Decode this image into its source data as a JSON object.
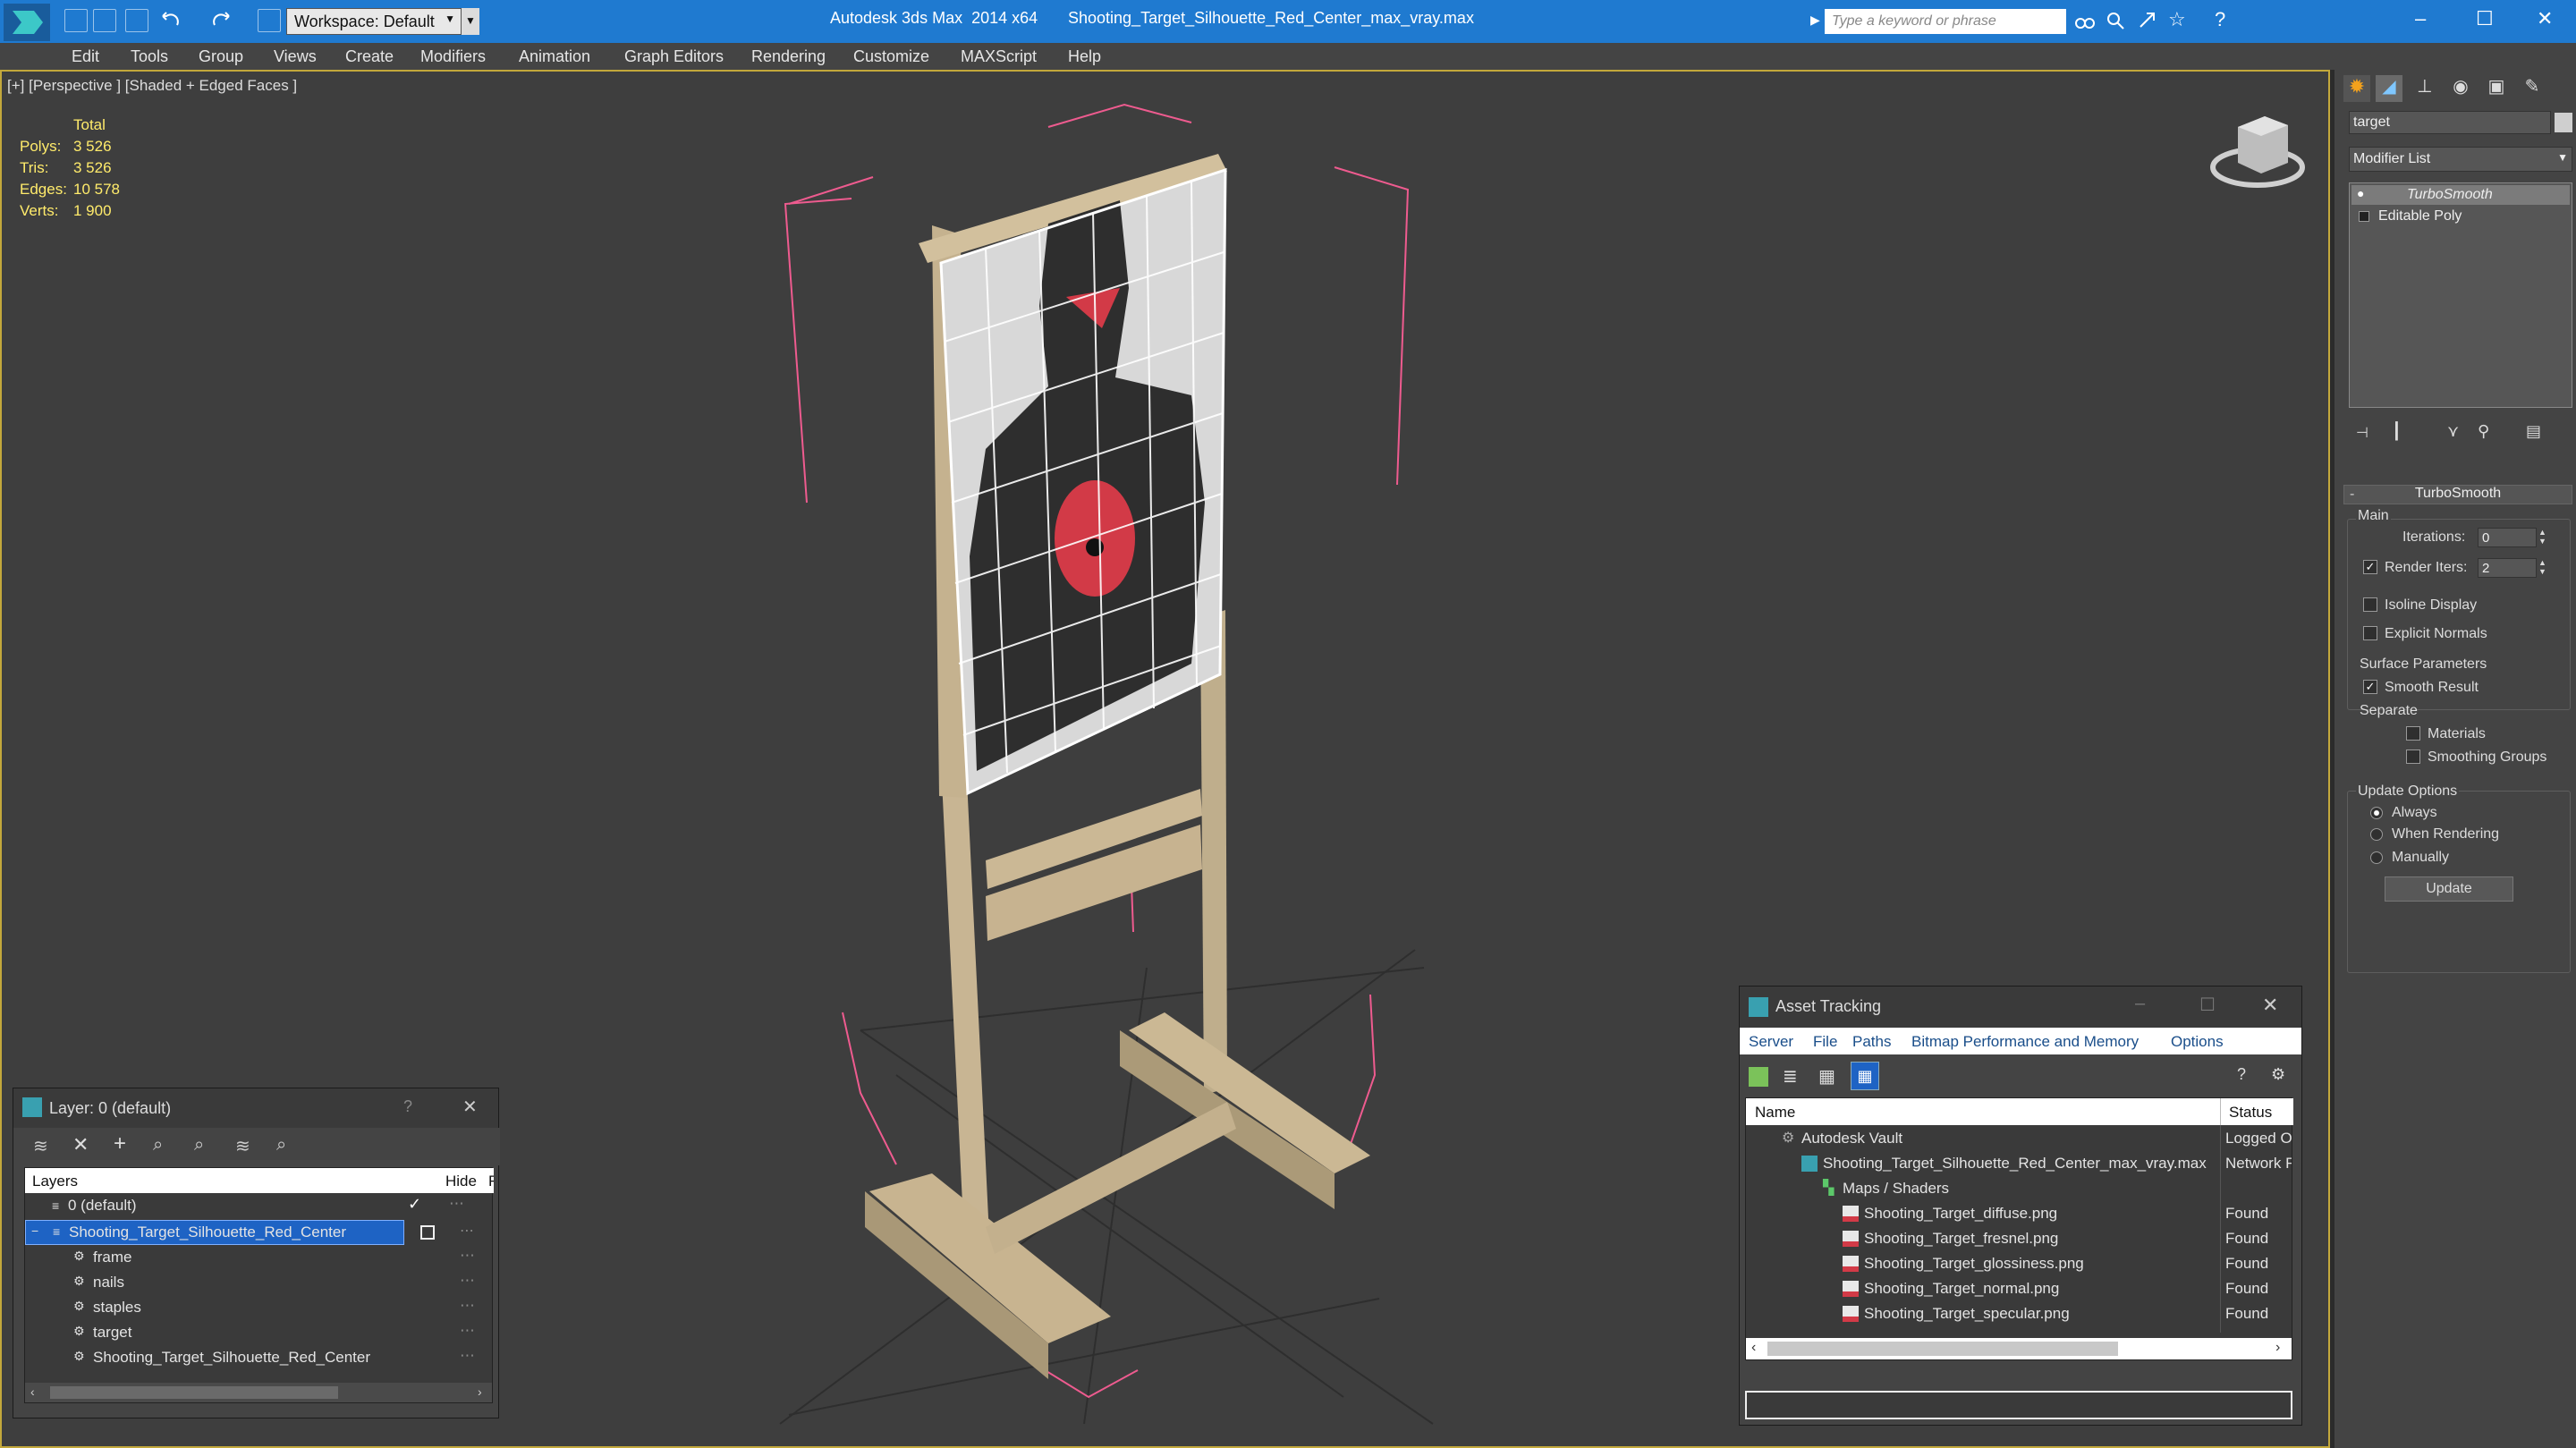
{
  "title": {
    "app": "Autodesk 3ds Max  2014 x64",
    "file": "Shooting_Target_Silhouette_Red_Center_max_vray.max"
  },
  "workspace": "Workspace: Default",
  "search": {
    "placeholder": "Type a keyword or phrase"
  },
  "menu": [
    "Edit",
    "Tools",
    "Group",
    "Views",
    "Create",
    "Modifiers",
    "Animation",
    "Graph Editors",
    "Rendering",
    "Customize",
    "MAXScript",
    "Help"
  ],
  "viewport": {
    "label": "[+] [Perspective ] [Shaded + Edged Faces ]",
    "stats": {
      "total_label": "Total",
      "rows": [
        {
          "k": "Polys:",
          "v": "3 526"
        },
        {
          "k": "Tris:",
          "v": "3 526"
        },
        {
          "k": "Edges:",
          "v": "10 578"
        },
        {
          "k": "Verts:",
          "v": "1 900"
        }
      ]
    }
  },
  "command_panel": {
    "object_name": "target",
    "modifier_list": "Modifier List",
    "stack": [
      "TurboSmooth",
      "Editable Poly"
    ],
    "rollout_title": "TurboSmooth",
    "main_label": "Main",
    "iterations_label": "Iterations:",
    "iterations_value": "0",
    "render_iters_label": "Render Iters:",
    "render_iters_value": "2",
    "render_iters_checked": true,
    "isoline_label": "Isoline Display",
    "explicit_label": "Explicit Normals",
    "surface_label": "Surface Parameters",
    "smooth_label": "Smooth Result",
    "smooth_checked": true,
    "separate_label": "Separate",
    "materials_label": "Materials",
    "smoothing_label": "Smoothing Groups",
    "update_label": "Update Options",
    "always_label": "Always",
    "when_rendering_label": "When Rendering",
    "manually_label": "Manually",
    "update_button": "Update"
  },
  "layer_panel": {
    "title": "Layer: 0 (default)",
    "help": "?",
    "col_layers": "Layers",
    "col_hide": "Hide",
    "col_f": "F",
    "rows": [
      "0 (default)",
      "Shooting_Target_Silhouette_Red_Center",
      "frame",
      "nails",
      "staples",
      "target",
      "Shooting_Target_Silhouette_Red_Center"
    ]
  },
  "asset_panel": {
    "title": "Asset Tracking",
    "menu": [
      "Server",
      "File",
      "Paths",
      "Bitmap Performance and Memory",
      "Options"
    ],
    "col_name": "Name",
    "col_status": "Status",
    "rows": [
      {
        "name": "Autodesk Vault",
        "status": "Logged O"
      },
      {
        "name": "Shooting_Target_Silhouette_Red_Center_max_vray.max",
        "status": "Network F"
      },
      {
        "name": "Maps / Shaders",
        "status": ""
      },
      {
        "name": "Shooting_Target_diffuse.png",
        "status": "Found"
      },
      {
        "name": "Shooting_Target_fresnel.png",
        "status": "Found"
      },
      {
        "name": "Shooting_Target_glossiness.png",
        "status": "Found"
      },
      {
        "name": "Shooting_Target_normal.png",
        "status": "Found"
      },
      {
        "name": "Shooting_Target_specular.png",
        "status": "Found"
      }
    ]
  },
  "colors": {
    "titlebar": "#1f7ad0",
    "viewport_border": "#c3a83b",
    "stat_yellow": "#ffeb6b",
    "selection": "#1e63c4"
  }
}
